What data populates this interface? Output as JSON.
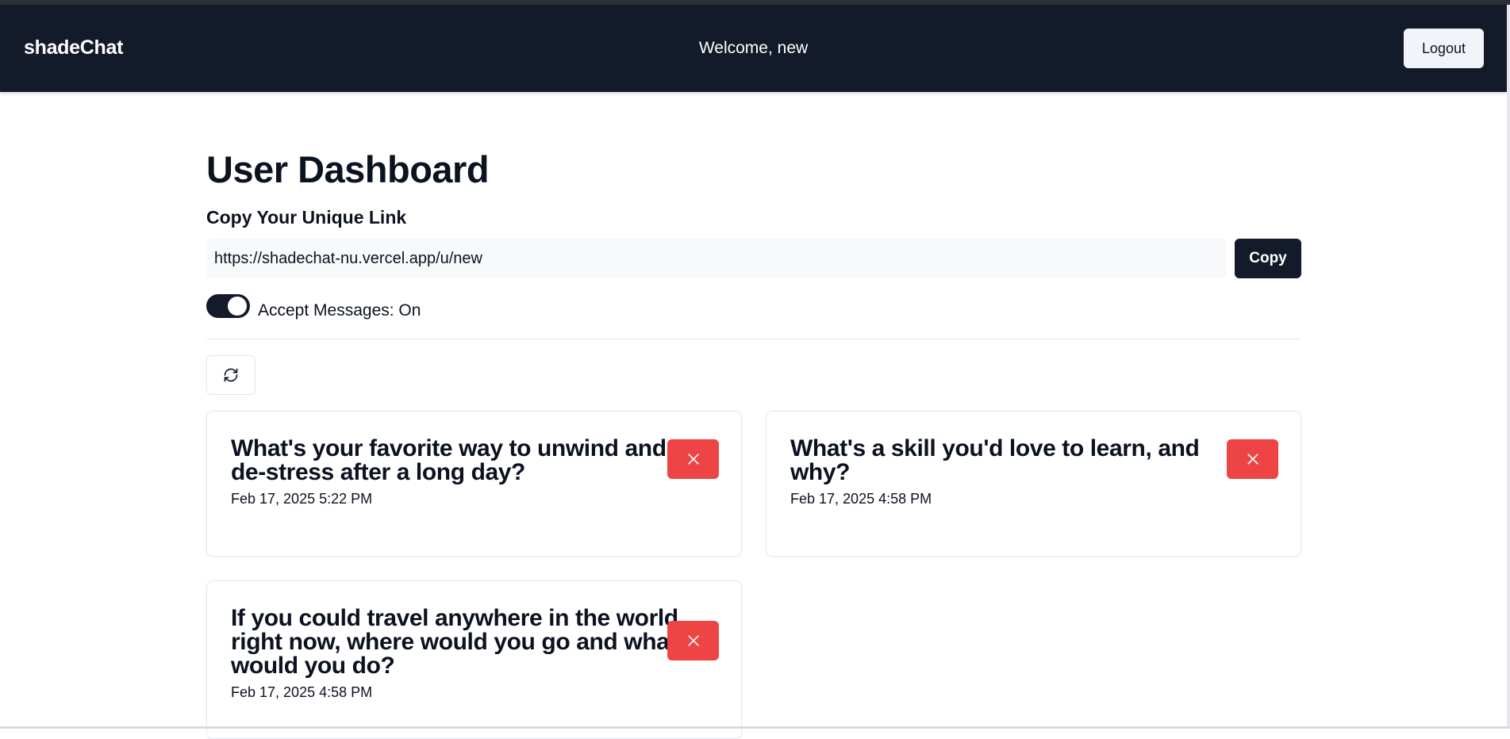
{
  "navbar": {
    "brand": "shadeChat",
    "welcome": "Welcome, new",
    "logout_label": "Logout"
  },
  "main": {
    "title": "User Dashboard",
    "link_section_label": "Copy Your Unique Link",
    "unique_link": "https://shadechat-nu.vercel.app/u/new",
    "copy_label": "Copy",
    "accept_messages_label": "Accept Messages: On",
    "accept_messages_on": true,
    "refresh_icon": "refresh-icon"
  },
  "messages": [
    {
      "content": "What's your favorite way to unwind and de-stress after a long day?",
      "date": "Feb 17, 2025 5:22 PM",
      "delete_icon": "close-icon"
    },
    {
      "content": "What's a skill you'd love to learn, and why?",
      "date": "Feb 17, 2025 4:58 PM",
      "delete_icon": "close-icon"
    },
    {
      "content": "If you could travel anywhere in the world right now, where would you go and what would you do?",
      "date": "Feb 17, 2025 4:58 PM",
      "delete_icon": "close-icon"
    }
  ],
  "colors": {
    "navbar_bg": "#131a2a",
    "primary": "#131a2a",
    "danger": "#ef4444",
    "text": "#0b1220"
  }
}
